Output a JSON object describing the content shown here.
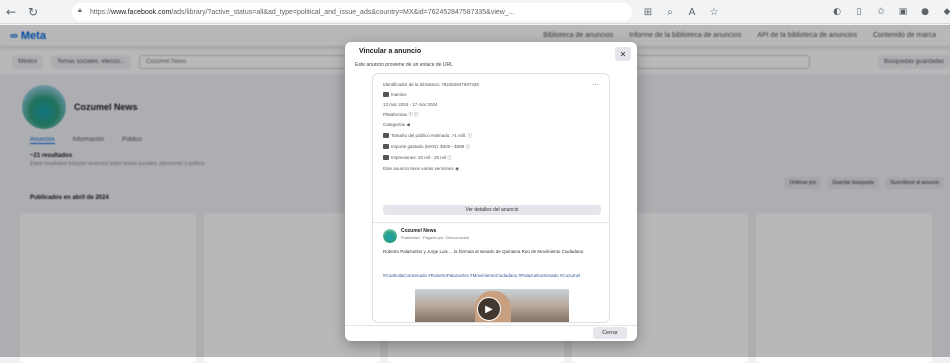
{
  "browser": {
    "url_prefix": "https://",
    "url_domain": "www.facebook.com",
    "url_path": "/ads/library/?active_status=all&ad_type=political_and_issue_ads&country=MX&id=762452847587335&view_..."
  },
  "page": {
    "logo": "∞ Meta",
    "nav_links": [
      "Biblioteca de anuncios",
      "Informe de la biblioteca de anuncios",
      "API de la biblioteca de anuncios",
      "Contenido de marca"
    ],
    "filter_country": "México",
    "filter_category": "Temas sociales, eleccio...",
    "search_value": "Cozumel News",
    "saved_searches": "Búsquedas guardadas",
    "profile_name": "Cozumel News",
    "tabs": [
      "Anuncios",
      "Información",
      "Público"
    ],
    "results_count": "~21 resultados",
    "results_note": "Estos resultados incluyen anuncios sobre temas sociales, elecciones o política.",
    "section_title": "Publicados en abril de 2024",
    "controls": [
      "Ordenar por",
      "Guardar búsqueda",
      "Suscribirse al anuncio"
    ]
  },
  "modal": {
    "title": "Vincular a anuncio",
    "subtitle": "Este anuncio proviene de un enlace de URL",
    "library_id": "Identificador de la biblioteca: 762452847587335",
    "status": "Inactivo",
    "dates": "13 mar 2024 - 17 mar 2024",
    "platforms_label": "Plataformas",
    "categories_label": "Categorías",
    "audience": "Tamaño del público estimado: >1 mill.",
    "spend": "Importe gastado (MXN): $300 - $399",
    "impressions": "Impresiones: 20 mil - 25 mil",
    "versions": "Este anuncio tiene varias versiones",
    "details_button": "Ver detalles del anuncio",
    "advertiser": "Cozumel News",
    "advertiser_meta": "Publicidad · Pagado por: Desconocido",
    "ad_text": "Roberto Palazuelos y Jorge Luis ... la fórmula al senado de Quintana Roo de Movimiento Ciudadano",
    "ad_tags": "#CoahuilaConSenado #RobertoPalazuelos #MovimientoCiudadano #PalazuelosSenado #Cozumel",
    "close_button": "Cerrar"
  }
}
